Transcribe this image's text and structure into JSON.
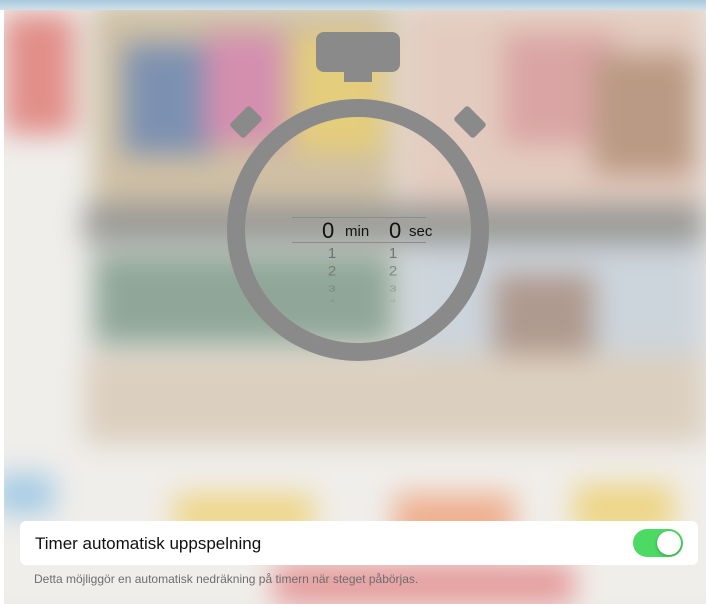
{
  "stopwatch": {
    "minutes": {
      "selected": "0",
      "unit": "min",
      "options": [
        "1",
        "2",
        "3",
        "4"
      ]
    },
    "seconds": {
      "selected": "0",
      "unit": "sec",
      "options": [
        "1",
        "2",
        "3",
        "4"
      ]
    },
    "icon": "stopwatch-icon",
    "color": "#8a8a8a"
  },
  "setting": {
    "label": "Timer automatisk uppspelning",
    "enabled": true,
    "toggle_color": "#4cd964",
    "description": "Detta möjliggör en automatisk nedräkning på timern när steget påbörjas."
  }
}
